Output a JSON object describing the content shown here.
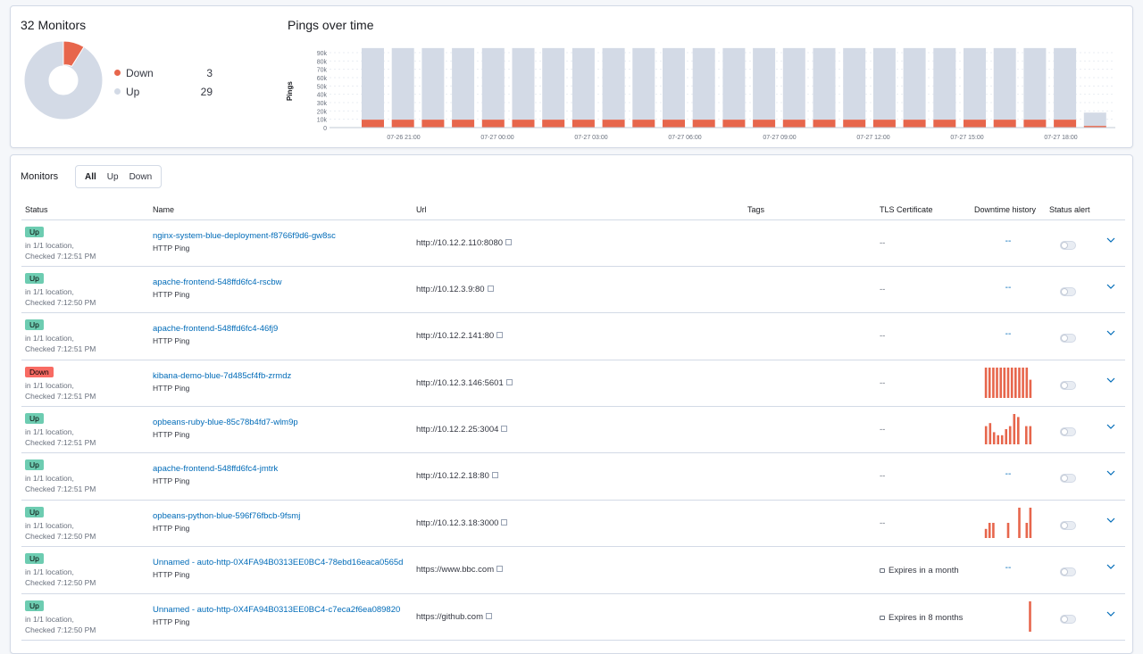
{
  "summary": {
    "monitors_title": "32 Monitors",
    "legend": [
      {
        "label": "Down",
        "count": "3",
        "color": "#e7664c"
      },
      {
        "label": "Up",
        "count": "29",
        "color": "#d3dae6"
      }
    ]
  },
  "pings_chart": {
    "title": "Pings over time",
    "chart_data": {
      "type": "bar",
      "ylabel": "Pings",
      "ylim": [
        0,
        90000
      ],
      "y_ticks": [
        "90k",
        "80k",
        "70k",
        "60k",
        "50k",
        "40k",
        "30k",
        "20k",
        "10k",
        "0"
      ],
      "x_ticks": [
        "07-26 21:00",
        "07-27 00:00",
        "07-27 03:00",
        "07-27 06:00",
        "07-27 09:00",
        "07-27 12:00",
        "07-27 15:00",
        "07-27 18:00"
      ],
      "series": [
        {
          "name": "Down",
          "color": "#e7664c",
          "values": [
            9500,
            9500,
            9500,
            9500,
            9500,
            9500,
            9500,
            9500,
            9500,
            9500,
            9500,
            9500,
            9500,
            9500,
            9500,
            9500,
            9500,
            9500,
            9500,
            9500,
            9500,
            9500,
            9500,
            9500,
            2000
          ]
        },
        {
          "name": "Up",
          "color": "#d3dae6",
          "values": [
            86000,
            86000,
            86000,
            86000,
            86000,
            86000,
            86000,
            86000,
            86000,
            86000,
            86000,
            86000,
            86000,
            86000,
            86000,
            86000,
            86000,
            86000,
            86000,
            86000,
            86000,
            86000,
            86000,
            86000,
            16000
          ]
        }
      ]
    }
  },
  "monitors": {
    "title": "Monitors",
    "filters": [
      "All",
      "Up",
      "Down"
    ],
    "columns": [
      "Status",
      "Name",
      "Url",
      "Tags",
      "TLS Certificate",
      "Downtime history",
      "Status alert"
    ],
    "rows": [
      {
        "status": "Up",
        "loc": "in 1/1 location,",
        "checked": "Checked 7:12:51 PM",
        "name": "nginx-system-blue-deployment-f8766f9d6-gw8sc",
        "type": "HTTP Ping",
        "url": "http://10.12.2.110:8080",
        "tls": "--",
        "downtime": "--",
        "spark": []
      },
      {
        "status": "Up",
        "loc": "in 1/1 location,",
        "checked": "Checked 7:12:50 PM",
        "name": "apache-frontend-548ffd6fc4-rscbw",
        "type": "HTTP Ping",
        "url": "http://10.12.3.9:80",
        "tls": "--",
        "downtime": "--",
        "spark": []
      },
      {
        "status": "Up",
        "loc": "in 1/1 location,",
        "checked": "Checked 7:12:51 PM",
        "name": "apache-frontend-548ffd6fc4-46fj9",
        "type": "HTTP Ping",
        "url": "http://10.12.2.141:80",
        "tls": "--",
        "downtime": "--",
        "spark": []
      },
      {
        "status": "Down",
        "loc": "in 1/1 location,",
        "checked": "Checked 7:12:51 PM",
        "name": "kibana-demo-blue-7d485cf4fb-zrmdz",
        "type": "HTTP Ping",
        "url": "http://10.12.3.146:5601",
        "tls": "--",
        "downtime": "",
        "spark": [
          10,
          10,
          10,
          10,
          10,
          10,
          10,
          10,
          10,
          10,
          10,
          10,
          6
        ]
      },
      {
        "status": "Up",
        "loc": "in 1/1 location,",
        "checked": "Checked 7:12:51 PM",
        "name": "opbeans-ruby-blue-85c78b4fd7-wlm9p",
        "type": "HTTP Ping",
        "url": "http://10.12.2.25:3004",
        "tls": "--",
        "downtime": "",
        "spark": [
          6,
          7,
          4,
          3,
          3,
          5,
          6,
          10,
          9,
          0,
          6,
          6
        ]
      },
      {
        "status": "Up",
        "loc": "in 1/1 location,",
        "checked": "Checked 7:12:51 PM",
        "name": "apache-frontend-548ffd6fc4-jmtrk",
        "type": "HTTP Ping",
        "url": "http://10.12.2.18:80",
        "tls": "--",
        "downtime": "--",
        "spark": []
      },
      {
        "status": "Up",
        "loc": "in 1/1 location,",
        "checked": "Checked 7:12:50 PM",
        "name": "opbeans-python-blue-596f76fbcb-9fsmj",
        "type": "HTTP Ping",
        "url": "http://10.12.3.18:3000",
        "tls": "--",
        "downtime": "",
        "spark": [
          3,
          5,
          5,
          0,
          0,
          0,
          5,
          0,
          0,
          10,
          0,
          5,
          10
        ]
      },
      {
        "status": "Up",
        "loc": "in 1/1 location,",
        "checked": "Checked 7:12:50 PM",
        "name": "Unnamed - auto-http-0X4FA94B0313EE0BC4-78ebd16eaca0565d",
        "type": "HTTP Ping",
        "url": "https://www.bbc.com",
        "tls": "Expires in a month",
        "downtime": "--",
        "spark": []
      },
      {
        "status": "Up",
        "loc": "in 1/1 location,",
        "checked": "Checked 7:12:50 PM",
        "name": "Unnamed - auto-http-0X4FA94B0313EE0BC4-c7eca2f6ea089820",
        "type": "HTTP Ping",
        "url": "https://github.com",
        "tls": "Expires in 8 months",
        "downtime": "",
        "spark": [
          0,
          0,
          0,
          0,
          0,
          0,
          0,
          0,
          0,
          0,
          10
        ]
      }
    ]
  },
  "colors": {
    "down": "#e7664c",
    "up_bar": "#d3dae6",
    "link": "#006bb8"
  }
}
